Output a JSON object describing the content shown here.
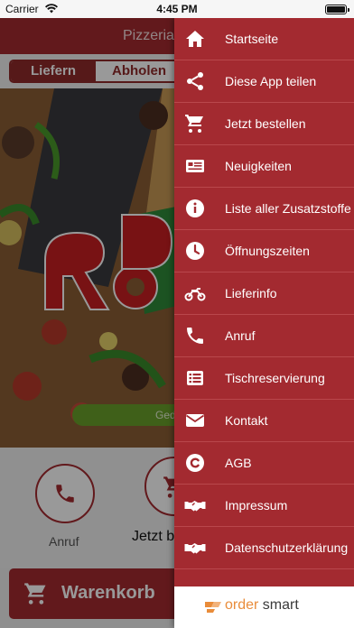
{
  "status_bar": {
    "carrier": "Carrier",
    "time": "4:45 PM"
  },
  "app": {
    "header_title": "Pizzeria",
    "tabs": [
      {
        "label": "Liefern",
        "selected": true
      },
      {
        "label": "Abholen",
        "selected": false
      }
    ],
    "hero_button_label": "Ged",
    "actions": [
      {
        "label": "Anruf",
        "icon": "phone-icon"
      },
      {
        "label": "Jetzt b",
        "icon": "cart-add-icon"
      }
    ],
    "cart_button_label": "Warenkorb"
  },
  "menu": {
    "items": [
      {
        "label": "Startseite",
        "icon": "home-icon"
      },
      {
        "label": "Diese App teilen",
        "icon": "share-icon"
      },
      {
        "label": "Jetzt bestellen",
        "icon": "cart-icon"
      },
      {
        "label": "Neuigkeiten",
        "icon": "newspaper-icon"
      },
      {
        "label": "Liste aller Zusatzstoffe",
        "icon": "info-icon"
      },
      {
        "label": "Öffnungszeiten",
        "icon": "clock-icon"
      },
      {
        "label": "Lieferinfo",
        "icon": "motorcycle-icon"
      },
      {
        "label": "Anruf",
        "icon": "phone-icon"
      },
      {
        "label": "Tischreservierung",
        "icon": "list-icon"
      },
      {
        "label": "Kontakt",
        "icon": "envelope-icon"
      },
      {
        "label": "AGB",
        "icon": "copyright-icon"
      },
      {
        "label": "Impressum",
        "icon": "handshake-icon"
      },
      {
        "label": "Datenschutzerklärung",
        "icon": "handshake-icon"
      }
    ],
    "footer": {
      "brand_part1": "order",
      "brand_part2": " smart"
    }
  },
  "colors": {
    "menu_bg": "#a32a30",
    "accent_orange": "#e98c3a",
    "tab_active": "#8f2a2a"
  }
}
